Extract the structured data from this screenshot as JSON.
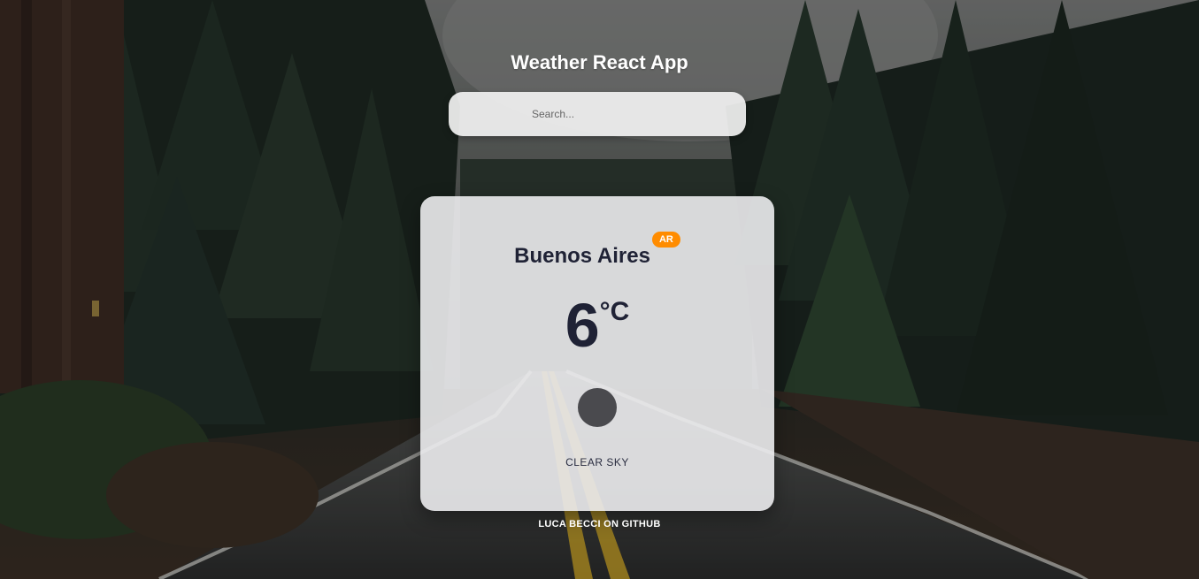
{
  "app": {
    "title": "Weather React App"
  },
  "search": {
    "placeholder": "Search...",
    "value": ""
  },
  "weather": {
    "city": "Buenos Aires",
    "country": "AR",
    "temperature": "6",
    "unit": "°C",
    "icon": "clear-sky-icon",
    "description": "CLEAR SKY"
  },
  "footer": {
    "link_label": "LUCA BECCI ON GITHUB"
  },
  "colors": {
    "badge": "#ff8c00",
    "text_dark": "#1f2235",
    "icon": "#4a4a4e"
  }
}
